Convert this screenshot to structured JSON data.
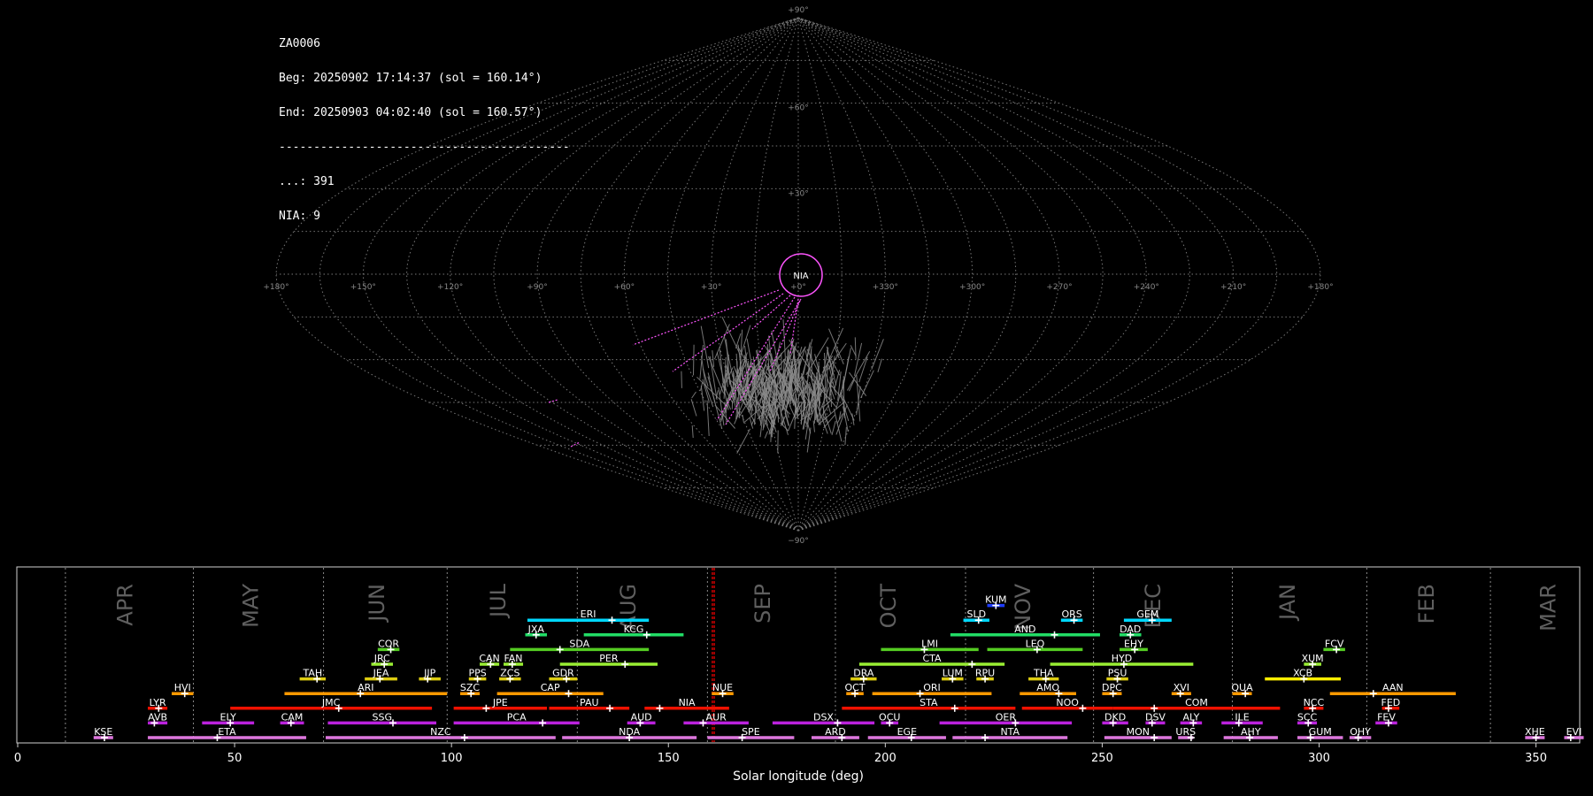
{
  "info": {
    "station": "ZA0006",
    "begin": "Beg: 20250902 17:14:37 (sol = 160.14°)",
    "end": "End: 20250903 04:02:40 (sol = 160.57°)",
    "separator": "------------------------------------------",
    "total_count": "...: 391",
    "shower_count": "NIA: 9"
  },
  "colors": {
    "background": "#000000",
    "grid": "#777777",
    "meteor_tracks": "#8a8a8a",
    "highlight": "#ff55ff",
    "current_sol": "#ff0000"
  },
  "chart_data": [
    {
      "type": "scatter",
      "title": "",
      "projection": "sinusoidal (all-sky radiant map)",
      "lon_ticks": [
        "+180°",
        "+150°",
        "+120°",
        "+90°",
        "+60°",
        "+30°",
        "+0°",
        "+330°",
        "+300°",
        "+270°",
        "+240°",
        "+210°",
        "+180°"
      ],
      "lat_ticks": [
        "+90°",
        "+60°",
        "+30°",
        "−90°"
      ],
      "highlight_shower": {
        "code": "NIA",
        "track_count": 9
      },
      "total_tracks": 391
    },
    {
      "type": "bar",
      "title": "",
      "xlabel": "Solar longitude (deg)",
      "xlim": [
        0,
        360
      ],
      "x_ticks": [
        0,
        50,
        100,
        150,
        200,
        250,
        300,
        350
      ],
      "month_labels": [
        {
          "label": "APR",
          "sol": 25
        },
        {
          "label": "MAY",
          "sol": 54
        },
        {
          "label": "JUN",
          "sol": 83
        },
        {
          "label": "JUL",
          "sol": 111
        },
        {
          "label": "AUG",
          "sol": 141
        },
        {
          "label": "SEP",
          "sol": 172
        },
        {
          "label": "OCT",
          "sol": 201
        },
        {
          "label": "NOV",
          "sol": 232
        },
        {
          "label": "DEC",
          "sol": 262
        },
        {
          "label": "JAN",
          "sol": 293
        },
        {
          "label": "FEB",
          "sol": 325
        },
        {
          "label": "MAR",
          "sol": 353
        }
      ],
      "month_boundaries": [
        11,
        40.5,
        70.5,
        99,
        129,
        159,
        188.5,
        218.5,
        248,
        280,
        311,
        339.5
      ],
      "current_sol": [
        160.14,
        160.57
      ],
      "showers": [
        {
          "code": "KUM",
          "start": 223.5,
          "end": 227.5,
          "peak": 225.5,
          "row": 9,
          "color": "#1e3cff"
        },
        {
          "code": "ERI",
          "start": 117.5,
          "end": 145.5,
          "peak": 137,
          "row": 8,
          "color": "#00d8ff"
        },
        {
          "code": "SLD",
          "start": 218,
          "end": 224,
          "peak": 221.5,
          "row": 8,
          "color": "#00d8ff"
        },
        {
          "code": "ORS",
          "start": 240.5,
          "end": 245.5,
          "peak": 243.5,
          "row": 8,
          "color": "#00d8ff"
        },
        {
          "code": "GEM",
          "start": 255,
          "end": 266,
          "peak": 261.5,
          "row": 8,
          "color": "#00d8ff"
        },
        {
          "code": "JXA",
          "start": 117,
          "end": 122,
          "peak": 119.5,
          "row": 7,
          "color": "#22dd66"
        },
        {
          "code": "KCG",
          "start": 130.5,
          "end": 153.5,
          "peak": 145,
          "row": 7,
          "color": "#22dd66"
        },
        {
          "code": "AND",
          "start": 215,
          "end": 249.5,
          "peak": 239,
          "row": 7,
          "color": "#22dd66"
        },
        {
          "code": "DAD",
          "start": 254,
          "end": 259,
          "peak": 256.5,
          "row": 7,
          "color": "#22dd66"
        },
        {
          "code": "COR",
          "start": 83,
          "end": 88,
          "peak": 86,
          "row": 6,
          "color": "#55cc22"
        },
        {
          "code": "SDA",
          "start": 113.5,
          "end": 145.5,
          "peak": 125,
          "row": 6,
          "color": "#55cc22"
        },
        {
          "code": "LMI",
          "start": 199,
          "end": 221.5,
          "peak": 209,
          "row": 6,
          "color": "#55cc22"
        },
        {
          "code": "LEQ",
          "start": 223.5,
          "end": 245.5,
          "peak": 235,
          "row": 6,
          "color": "#55cc22"
        },
        {
          "code": "EHY",
          "start": 254,
          "end": 260.5,
          "peak": 257.5,
          "row": 6,
          "color": "#55cc22"
        },
        {
          "code": "FCV",
          "start": 301,
          "end": 306,
          "peak": 304,
          "row": 6,
          "color": "#55cc22"
        },
        {
          "code": "JRC",
          "start": 81.5,
          "end": 86.5,
          "peak": 84.5,
          "row": 5,
          "color": "#99ee33"
        },
        {
          "code": "CAN",
          "start": 106.5,
          "end": 111,
          "peak": 109,
          "row": 5,
          "color": "#99ee33"
        },
        {
          "code": "FAN",
          "start": 112,
          "end": 116.5,
          "peak": 114,
          "row": 5,
          "color": "#99ee33"
        },
        {
          "code": "PER",
          "start": 125,
          "end": 147.5,
          "peak": 140,
          "row": 5,
          "color": "#99ee33"
        },
        {
          "code": "CTA",
          "start": 194,
          "end": 227.5,
          "peak": 220,
          "row": 5,
          "color": "#99ee33"
        },
        {
          "code": "HYD",
          "start": 238,
          "end": 271,
          "peak": 255,
          "row": 5,
          "color": "#99ee33"
        },
        {
          "code": "XUM",
          "start": 296.5,
          "end": 300.5,
          "peak": 298.5,
          "row": 5,
          "color": "#99ee33"
        },
        {
          "code": "TAH",
          "start": 65,
          "end": 71,
          "peak": 69,
          "row": 4,
          "color": "#ddcc11"
        },
        {
          "code": "JEA",
          "start": 80,
          "end": 87.5,
          "peak": 83.5,
          "row": 4,
          "color": "#ddcc11"
        },
        {
          "code": "JIP",
          "start": 92.5,
          "end": 97.5,
          "peak": 94.5,
          "row": 4,
          "color": "#ddcc11"
        },
        {
          "code": "PPS",
          "start": 104,
          "end": 108,
          "peak": 106,
          "row": 4,
          "color": "#ddcc11"
        },
        {
          "code": "ZCS",
          "start": 111,
          "end": 116,
          "peak": 113.5,
          "row": 4,
          "color": "#ddcc11"
        },
        {
          "code": "GDR",
          "start": 122.5,
          "end": 129,
          "peak": 126.5,
          "row": 4,
          "color": "#ddcc11"
        },
        {
          "code": "DRA",
          "start": 192,
          "end": 198,
          "peak": 195,
          "row": 4,
          "color": "#ddcc11"
        },
        {
          "code": "LUM",
          "start": 213,
          "end": 218,
          "peak": 215.5,
          "row": 4,
          "color": "#ddcc11"
        },
        {
          "code": "RPU",
          "start": 221,
          "end": 225,
          "peak": 223,
          "row": 4,
          "color": "#ddcc11"
        },
        {
          "code": "THA",
          "start": 233,
          "end": 240,
          "peak": 237,
          "row": 4,
          "color": "#ddcc11"
        },
        {
          "code": "PSU",
          "start": 251,
          "end": 256,
          "peak": 253.5,
          "row": 4,
          "color": "#ddcc11"
        },
        {
          "code": "XCB",
          "start": 287.5,
          "end": 305,
          "peak": 296.5,
          "row": 4,
          "color": "#ffee00"
        },
        {
          "code": "HVI",
          "start": 35.5,
          "end": 40.5,
          "peak": 38.5,
          "row": 3,
          "color": "#ff9900"
        },
        {
          "code": "ARI",
          "start": 61.5,
          "end": 99,
          "peak": 79,
          "row": 3,
          "color": "#ff9900"
        },
        {
          "code": "SZC",
          "start": 102,
          "end": 106.5,
          "peak": 104.5,
          "row": 3,
          "color": "#ff9900"
        },
        {
          "code": "CAP",
          "start": 110.5,
          "end": 135,
          "peak": 127,
          "row": 3,
          "color": "#ff9900"
        },
        {
          "code": "NUE",
          "start": 160,
          "end": 165,
          "peak": 162.5,
          "row": 3,
          "color": "#ff9900"
        },
        {
          "code": "OCT",
          "start": 191,
          "end": 195,
          "peak": 193,
          "row": 3,
          "color": "#ff9900"
        },
        {
          "code": "ORI",
          "start": 197,
          "end": 224.5,
          "peak": 208,
          "row": 3,
          "color": "#ff9900"
        },
        {
          "code": "AMO",
          "start": 231,
          "end": 244,
          "peak": 240,
          "row": 3,
          "color": "#ff9900"
        },
        {
          "code": "DPC",
          "start": 250,
          "end": 254.5,
          "peak": 252.5,
          "row": 3,
          "color": "#ff9900"
        },
        {
          "code": "XVI",
          "start": 266,
          "end": 270.5,
          "peak": 268,
          "row": 3,
          "color": "#ff9900"
        },
        {
          "code": "QUA",
          "start": 280,
          "end": 284.5,
          "peak": 283,
          "row": 3,
          "color": "#ff9900"
        },
        {
          "code": "AAN",
          "start": 302.5,
          "end": 331.5,
          "peak": 312.5,
          "row": 3,
          "color": "#ff9900"
        },
        {
          "code": "LYR",
          "start": 30,
          "end": 34.5,
          "peak": 32.5,
          "row": 2,
          "color": "#ee1100"
        },
        {
          "code": "JMC",
          "start": 49,
          "end": 95.5,
          "peak": 74,
          "row": 2,
          "color": "#ee1100"
        },
        {
          "code": "JPE",
          "start": 100.5,
          "end": 122,
          "peak": 108,
          "row": 2,
          "color": "#ee1100"
        },
        {
          "code": "PAU",
          "start": 122.5,
          "end": 141,
          "peak": 136.5,
          "row": 2,
          "color": "#ee1100"
        },
        {
          "code": "NIA",
          "start": 144.5,
          "end": 164,
          "peak": 148,
          "row": 2,
          "color": "#ee1100"
        },
        {
          "code": "STA",
          "start": 190,
          "end": 230,
          "peak": 216,
          "row": 2,
          "color": "#ee1100"
        },
        {
          "code": "NOO",
          "start": 231.5,
          "end": 252.5,
          "peak": 245.5,
          "row": 2,
          "color": "#ee1100"
        },
        {
          "code": "COM",
          "start": 252.5,
          "end": 291,
          "peak": 262,
          "row": 2,
          "color": "#ee1100"
        },
        {
          "code": "NCC",
          "start": 296.5,
          "end": 301,
          "peak": 298.5,
          "row": 2,
          "color": "#ee1100"
        },
        {
          "code": "FED",
          "start": 314.5,
          "end": 318.5,
          "peak": 316,
          "row": 2,
          "color": "#ee1100"
        },
        {
          "code": "AVB",
          "start": 30,
          "end": 34.5,
          "peak": 31.5,
          "row": 1,
          "color": "#bb22dd"
        },
        {
          "code": "ELY",
          "start": 42.5,
          "end": 54.5,
          "peak": 49,
          "row": 1,
          "color": "#bb22dd"
        },
        {
          "code": "CAM",
          "start": 60.5,
          "end": 66,
          "peak": 63,
          "row": 1,
          "color": "#bb22dd"
        },
        {
          "code": "SSG",
          "start": 71.5,
          "end": 96.5,
          "peak": 86.5,
          "row": 1,
          "color": "#bb22dd"
        },
        {
          "code": "PCA",
          "start": 100.5,
          "end": 129.5,
          "peak": 121,
          "row": 1,
          "color": "#bb22dd"
        },
        {
          "code": "AUD",
          "start": 140.5,
          "end": 147,
          "peak": 143.5,
          "row": 1,
          "color": "#bb22dd"
        },
        {
          "code": "AUR",
          "start": 153.5,
          "end": 168.5,
          "peak": 158,
          "row": 1,
          "color": "#bb22dd"
        },
        {
          "code": "DSX",
          "start": 174,
          "end": 197.5,
          "peak": 189,
          "row": 1,
          "color": "#bb22dd"
        },
        {
          "code": "OCU",
          "start": 199,
          "end": 203,
          "peak": 201,
          "row": 1,
          "color": "#bb22dd"
        },
        {
          "code": "OER",
          "start": 212.5,
          "end": 243,
          "peak": 230,
          "row": 1,
          "color": "#bb22dd"
        },
        {
          "code": "DKD",
          "start": 250,
          "end": 256,
          "peak": 252.5,
          "row": 1,
          "color": "#bb22dd"
        },
        {
          "code": "DSV",
          "start": 260,
          "end": 264.5,
          "peak": 261.5,
          "row": 1,
          "color": "#bb22dd"
        },
        {
          "code": "ALY",
          "start": 268,
          "end": 273,
          "peak": 271,
          "row": 1,
          "color": "#bb22dd"
        },
        {
          "code": "ILE",
          "start": 277.5,
          "end": 287,
          "peak": 281.5,
          "row": 1,
          "color": "#bb22dd"
        },
        {
          "code": "SCC",
          "start": 295,
          "end": 299.5,
          "peak": 297.5,
          "row": 1,
          "color": "#bb22dd"
        },
        {
          "code": "FEV",
          "start": 313,
          "end": 318,
          "peak": 316,
          "row": 1,
          "color": "#bb22dd"
        },
        {
          "code": "KSE",
          "start": 17.5,
          "end": 22,
          "peak": 20,
          "row": 0,
          "color": "#dd77dd"
        },
        {
          "code": "ETA",
          "start": 30,
          "end": 66.5,
          "peak": 46,
          "row": 0,
          "color": "#dd77dd"
        },
        {
          "code": "NZC",
          "start": 71,
          "end": 124,
          "peak": 103,
          "row": 0,
          "color": "#dd77dd"
        },
        {
          "code": "NDA",
          "start": 125.5,
          "end": 156.5,
          "peak": 141,
          "row": 0,
          "color": "#dd77dd"
        },
        {
          "code": "SPE",
          "start": 159,
          "end": 179,
          "peak": 167,
          "row": 0,
          "color": "#dd77dd"
        },
        {
          "code": "ARD",
          "start": 183,
          "end": 194,
          "peak": 190,
          "row": 0,
          "color": "#dd77dd"
        },
        {
          "code": "EGE",
          "start": 196,
          "end": 214,
          "peak": 206,
          "row": 0,
          "color": "#dd77dd"
        },
        {
          "code": "NTA",
          "start": 215.5,
          "end": 242,
          "peak": 223,
          "row": 0,
          "color": "#dd77dd"
        },
        {
          "code": "MON",
          "start": 250.5,
          "end": 266,
          "peak": 262,
          "row": 0,
          "color": "#dd77dd"
        },
        {
          "code": "URS",
          "start": 267.5,
          "end": 271,
          "peak": 270.5,
          "row": 0,
          "color": "#dd77dd"
        },
        {
          "code": "AHY",
          "start": 278,
          "end": 290.5,
          "peak": 284,
          "row": 0,
          "color": "#dd77dd"
        },
        {
          "code": "GUM",
          "start": 295,
          "end": 305.5,
          "peak": 298,
          "row": 0,
          "color": "#dd77dd"
        },
        {
          "code": "OHY",
          "start": 307,
          "end": 312,
          "peak": 309,
          "row": 0,
          "color": "#dd77dd"
        },
        {
          "code": "XHE",
          "start": 347.5,
          "end": 352,
          "peak": 350,
          "row": 0,
          "color": "#dd77dd"
        },
        {
          "code": "EVI",
          "start": 356.5,
          "end": 361,
          "peak": 358,
          "row": 0,
          "color": "#dd77dd"
        }
      ]
    }
  ]
}
